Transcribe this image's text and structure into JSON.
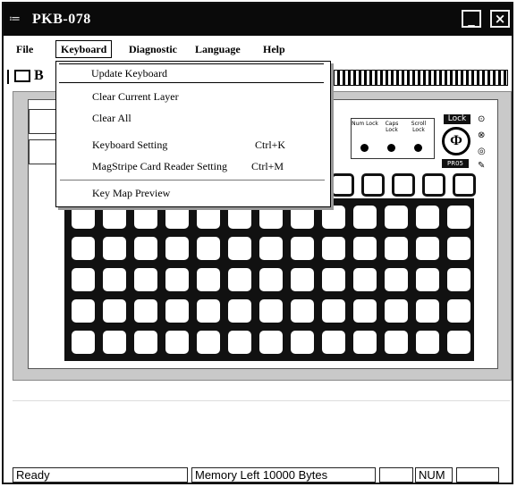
{
  "window": {
    "title": "PKB-078"
  },
  "menubar": {
    "items": [
      {
        "label": "File"
      },
      {
        "label": "Keyboard"
      },
      {
        "label": "Diagnostic"
      },
      {
        "label": "Language"
      },
      {
        "label": "Help"
      }
    ]
  },
  "keyboard_menu": {
    "items": [
      {
        "label": "Update Keyboard",
        "shortcut": ""
      },
      {
        "label": "Clear Current Layer",
        "shortcut": ""
      },
      {
        "label": "Clear All",
        "shortcut": ""
      },
      {
        "label": "Keyboard Setting",
        "shortcut": "Ctrl+K"
      },
      {
        "label": "MagStripe Card Reader Setting",
        "shortcut": "Ctrl+M"
      },
      {
        "label": "Key Map Preview",
        "shortcut": ""
      }
    ]
  },
  "led_panel": {
    "num_label": "Num Lock",
    "caps_label": "Caps Lock",
    "scroll_label": "Scroll Lock",
    "lock_tag": "Lock",
    "lock_sub": "PR05"
  },
  "statusbar": {
    "ready": "Ready",
    "memory": "Memory Left   10000 Bytes",
    "num": "NUM"
  },
  "colors": {
    "titlebar": "#0a0a0a",
    "grid_bg": "#111111",
    "work_area": "#c9c9c9"
  },
  "icons": [
    "app-icon",
    "minimize-icon",
    "close-icon",
    "folder-icon",
    "lock-dial-icon"
  ]
}
